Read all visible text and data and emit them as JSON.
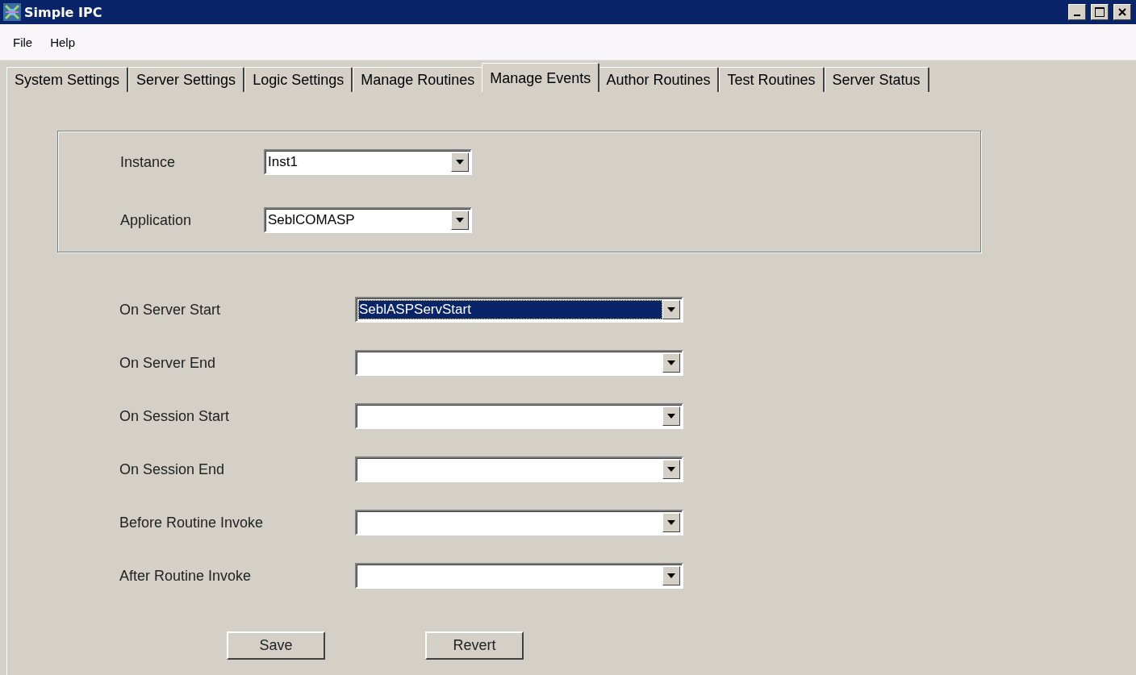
{
  "window": {
    "title": "Simple IPC"
  },
  "menu": [
    "File",
    "Help"
  ],
  "tabs": [
    {
      "label": "System Settings",
      "selected": false
    },
    {
      "label": "Server Settings",
      "selected": false
    },
    {
      "label": "Logic Settings",
      "selected": false
    },
    {
      "label": "Manage Routines",
      "selected": false
    },
    {
      "label": "Manage Events",
      "selected": true
    },
    {
      "label": "Author Routines",
      "selected": false
    },
    {
      "label": "Test Routines",
      "selected": false
    },
    {
      "label": "Server Status",
      "selected": false
    }
  ],
  "scope": [
    {
      "label": "Instance",
      "value": "Inst1",
      "focused": false
    },
    {
      "label": "Application",
      "value": "SeblCOMASP",
      "focused": false
    }
  ],
  "events": [
    {
      "label": "On Server Start",
      "value": "SeblASPServStart",
      "focused": true
    },
    {
      "label": "On Server End",
      "focused": false
    },
    {
      "label": "On Session Start",
      "focused": false
    },
    {
      "label": "On Session End",
      "focused": false
    },
    {
      "label": "Before Routine Invoke",
      "focused": false
    },
    {
      "label": "After Routine Invoke",
      "focused": false
    }
  ],
  "buttons": [
    "Save",
    "Revert"
  ]
}
